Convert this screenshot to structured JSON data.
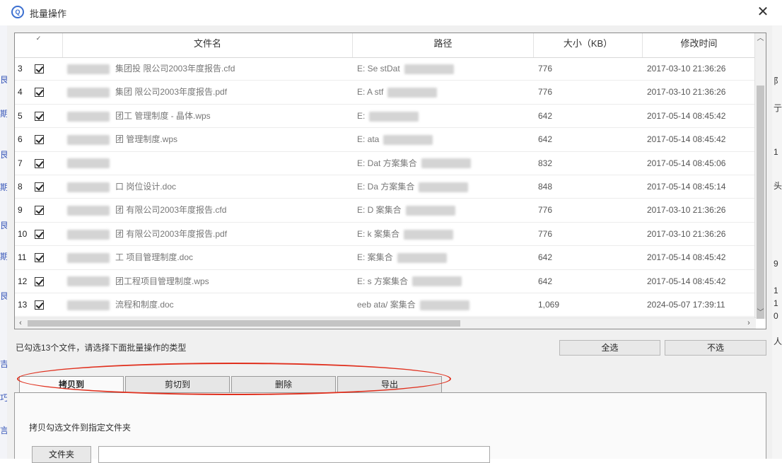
{
  "window": {
    "title": "批量操作",
    "app_icon": "qq-pcmanager-icon"
  },
  "table": {
    "columns": {
      "check": "✓",
      "name": "文件名",
      "path": "路径",
      "size": "大小（KB）",
      "time": "修改时间"
    },
    "rows": [
      {
        "num": "3",
        "checked": true,
        "name_visible": "集团投      限公司2003年度报告.cfd",
        "path_visible": "E:      Se      stDat",
        "size": "776",
        "time": "2017-03-10 21:36:26"
      },
      {
        "num": "4",
        "checked": true,
        "name_visible": "集团        限公司2003年度报告.pdf",
        "path_visible": "E:      A       stf",
        "size": "776",
        "time": "2017-03-10 21:36:26"
      },
      {
        "num": "5",
        "checked": true,
        "name_visible": "团工        管理制度 - 晶体.wps",
        "path_visible": "E:",
        "size": "642",
        "time": "2017-05-14 08:45:42"
      },
      {
        "num": "6",
        "checked": true,
        "name_visible": "团          管理制度.wps",
        "path_visible": "E:      ata",
        "size": "642",
        "time": "2017-05-14 08:45:42"
      },
      {
        "num": "7",
        "checked": true,
        "name_visible": "",
        "path_visible": "E:      Dat      方案集合",
        "size": "832",
        "time": "2017-05-14 08:45:06"
      },
      {
        "num": "8",
        "checked": true,
        "name_visible": "口          岗位设计.doc",
        "path_visible": "E:      Da      方案集合",
        "size": "848",
        "time": "2017-05-14 08:45:14"
      },
      {
        "num": "9",
        "checked": true,
        "name_visible": "团          有限公司2003年度报告.cfd",
        "path_visible": "E:      D       案集合",
        "size": "776",
        "time": "2017-03-10 21:36:26"
      },
      {
        "num": "10",
        "checked": true,
        "name_visible": "团          有限公司2003年度报告.pdf",
        "path_visible": "E:      k       案集合",
        "size": "776",
        "time": "2017-03-10 21:36:26"
      },
      {
        "num": "11",
        "checked": true,
        "name_visible": "工          项目管理制度.doc",
        "path_visible": "E:              案集合",
        "size": "642",
        "time": "2017-05-14 08:45:42"
      },
      {
        "num": "12",
        "checked": true,
        "name_visible": "团工程项目管理制度.wps",
        "path_visible": "E:      s       方案集合",
        "size": "642",
        "time": "2017-05-14 08:45:42"
      },
      {
        "num": "13",
        "checked": true,
        "name_visible": "流程和制度.doc",
        "path_visible": "eeb      ata/      案集合",
        "size": "1,069",
        "time": "2024-05-07 17:39:11"
      }
    ]
  },
  "status": {
    "text": "已勾选13个文件，请选择下面批量操作的类型"
  },
  "buttons": {
    "select_all": "全选",
    "select_none": "不选"
  },
  "tabs": [
    {
      "label": "拷贝到",
      "active": true
    },
    {
      "label": "剪切到",
      "active": false
    },
    {
      "label": "删除",
      "active": false
    },
    {
      "label": "导出",
      "active": false
    }
  ],
  "panel": {
    "description": "拷贝勾选文件到指定文件夹",
    "folder_button": "文件夹",
    "folder_value": ""
  },
  "colors": {
    "highlight": "#e0301e",
    "accent": "#3b6fd0"
  },
  "background": {
    "left_chars": [
      "艮",
      "期",
      "艮",
      "期",
      "艮",
      "期",
      "艮",
      "吉",
      "巧",
      "言"
    ],
    "right_chars": [
      "阝",
      "亍",
      "1",
      "头",
      "9",
      "1",
      "1",
      "0",
      "人"
    ]
  }
}
